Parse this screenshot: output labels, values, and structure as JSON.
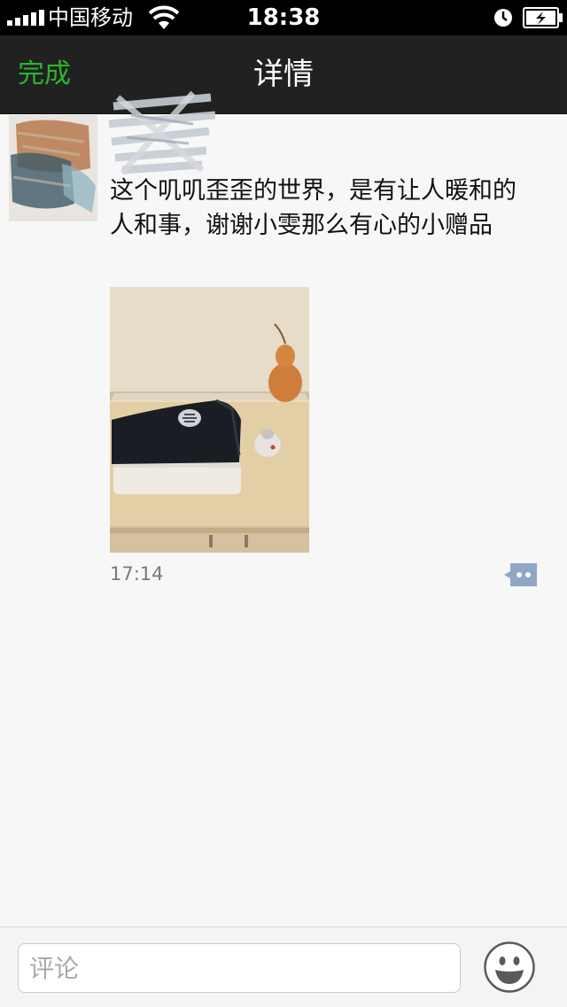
{
  "status_bar": {
    "carrier": "中国移动",
    "time": "18:38",
    "icons": [
      "signal-icon",
      "wifi-icon",
      "clock-icon",
      "battery-charging-icon"
    ]
  },
  "nav": {
    "done_label": "完成",
    "title": "详情"
  },
  "post": {
    "text": "这个叽叽歪歪的世界，是有让人暖和的人和事，谢谢小雯那么有心的小赠品",
    "time": "17:14"
  },
  "comment_bar": {
    "placeholder": "评论",
    "value": ""
  },
  "colors": {
    "accent_green": "#2cb52a",
    "nav_background": "#212121",
    "page_background": "#f7f7f7",
    "comment_icon": "#8fa6c6"
  }
}
